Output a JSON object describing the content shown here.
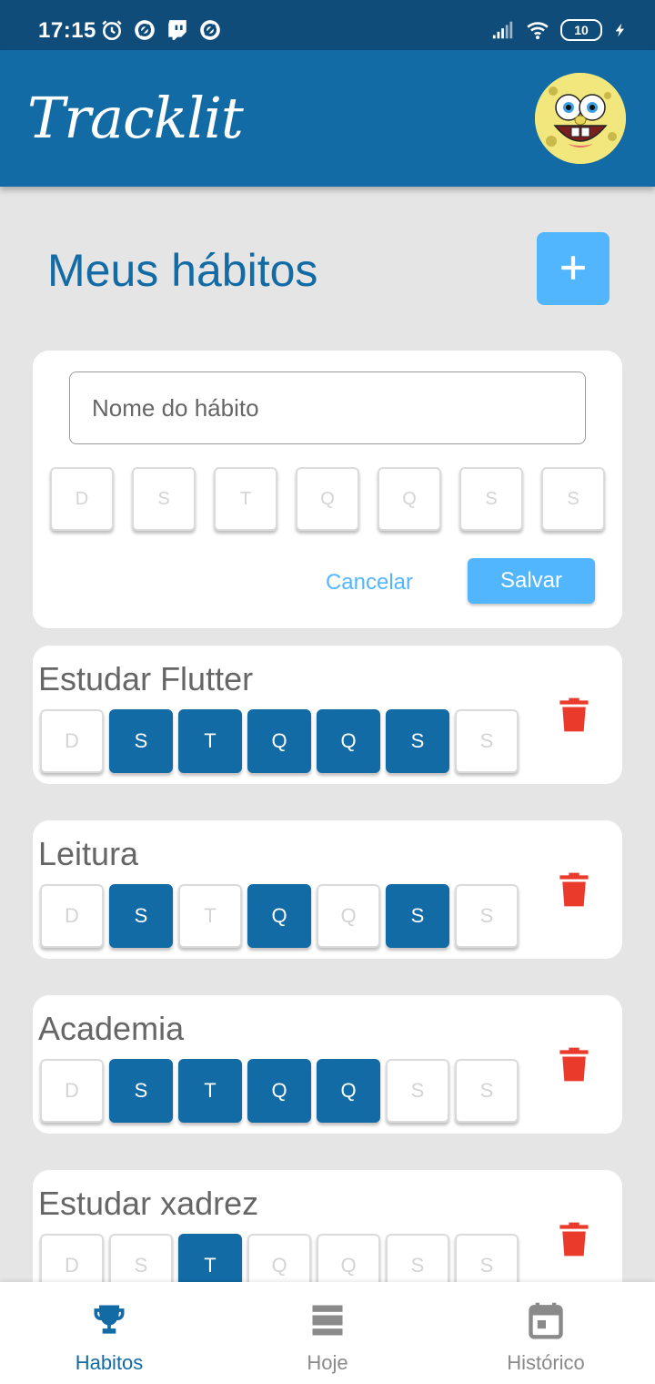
{
  "status_bar": {
    "time": "17:15",
    "battery": "10"
  },
  "header": {
    "app_name": "Tracklit"
  },
  "page": {
    "title": "Meus hábitos",
    "add_button": "+"
  },
  "create_form": {
    "placeholder": "Nome do hábito",
    "days": [
      "D",
      "S",
      "T",
      "Q",
      "Q",
      "S",
      "S"
    ],
    "cancel": "Cancelar",
    "save": "Salvar"
  },
  "habits": [
    {
      "name": "Estudar Flutter",
      "days": [
        {
          "l": "D",
          "on": false
        },
        {
          "l": "S",
          "on": true
        },
        {
          "l": "T",
          "on": true
        },
        {
          "l": "Q",
          "on": true
        },
        {
          "l": "Q",
          "on": true
        },
        {
          "l": "S",
          "on": true
        },
        {
          "l": "S",
          "on": false
        }
      ]
    },
    {
      "name": "Leitura",
      "days": [
        {
          "l": "D",
          "on": false
        },
        {
          "l": "S",
          "on": true
        },
        {
          "l": "T",
          "on": false
        },
        {
          "l": "Q",
          "on": true
        },
        {
          "l": "Q",
          "on": false
        },
        {
          "l": "S",
          "on": true
        },
        {
          "l": "S",
          "on": false
        }
      ]
    },
    {
      "name": "Academia",
      "days": [
        {
          "l": "D",
          "on": false
        },
        {
          "l": "S",
          "on": true
        },
        {
          "l": "T",
          "on": true
        },
        {
          "l": "Q",
          "on": true
        },
        {
          "l": "Q",
          "on": true
        },
        {
          "l": "S",
          "on": false
        },
        {
          "l": "S",
          "on": false
        }
      ]
    },
    {
      "name": "Estudar xadrez",
      "days": [
        {
          "l": "D",
          "on": false
        },
        {
          "l": "S",
          "on": false
        },
        {
          "l": "T",
          "on": true
        },
        {
          "l": "Q",
          "on": false
        },
        {
          "l": "Q",
          "on": false
        },
        {
          "l": "S",
          "on": false
        },
        {
          "l": "S",
          "on": false
        }
      ]
    }
  ],
  "bottom_nav": [
    {
      "label": "Habitos",
      "icon": "trophy-icon",
      "active": true
    },
    {
      "label": "Hoje",
      "icon": "today-icon",
      "active": false
    },
    {
      "label": "Histórico",
      "icon": "calendar-icon",
      "active": false
    }
  ],
  "colors": {
    "primary": "#126ba5",
    "accent": "#52b6ff",
    "delete": "#ea3a2b",
    "inactive_nav": "#8a8a8a"
  }
}
